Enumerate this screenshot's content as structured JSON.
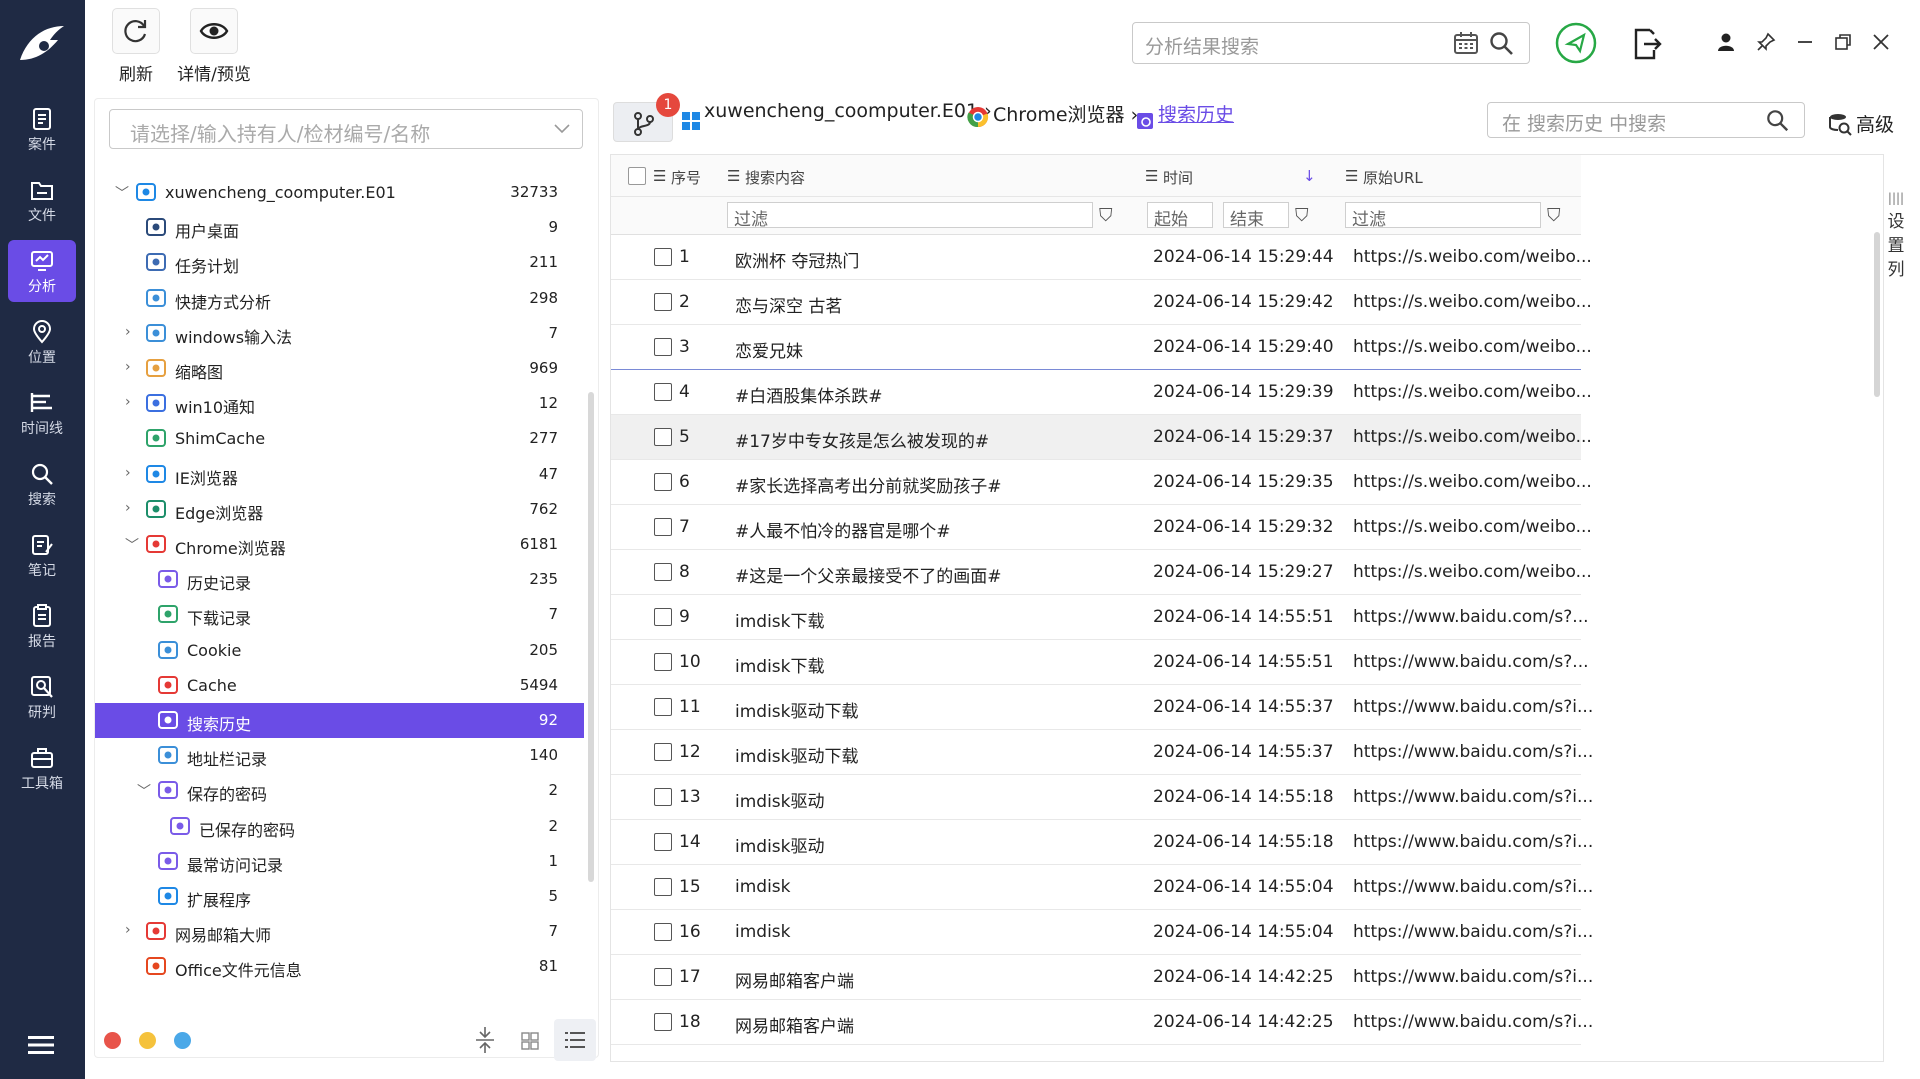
{
  "nav": {
    "items": [
      {
        "label": "案件",
        "icon": "case-icon"
      },
      {
        "label": "文件",
        "icon": "folder-icon"
      },
      {
        "label": "分析",
        "icon": "analysis-icon",
        "active": true
      },
      {
        "label": "位置",
        "icon": "location-icon"
      },
      {
        "label": "时间线",
        "icon": "timeline-icon"
      },
      {
        "label": "搜索",
        "icon": "search-icon"
      },
      {
        "label": "笔记",
        "icon": "note-icon"
      },
      {
        "label": "报告",
        "icon": "report-icon"
      },
      {
        "label": "研判",
        "icon": "judge-icon"
      },
      {
        "label": "工具箱",
        "icon": "toolbox-icon"
      }
    ],
    "active_color": "#6a4ce6",
    "bg_color": "#1f2a44"
  },
  "toolbar": {
    "refresh_label": "刷新",
    "detail_label": "详情/预览",
    "search_placeholder": "分析结果搜索"
  },
  "left": {
    "person_placeholder": "请选择/输入持有人/检材编号/名称",
    "tree": [
      {
        "label": "xuwencheng_coomputer.E01",
        "count": "32733",
        "level": 0,
        "expanded": true,
        "icon": "windows-icon"
      },
      {
        "label": "用户桌面",
        "count": "9",
        "level": 1,
        "icon": "desktop-icon"
      },
      {
        "label": "任务计划",
        "count": "211",
        "level": 1,
        "icon": "task-icon"
      },
      {
        "label": "快捷方式分析",
        "count": "298",
        "level": 1,
        "icon": "shortcut-icon"
      },
      {
        "label": "windows输入法",
        "count": "7",
        "level": 1,
        "collapsed": true,
        "icon": "keyboard-icon"
      },
      {
        "label": "缩略图",
        "count": "969",
        "level": 1,
        "collapsed": true,
        "icon": "thumbnail-icon"
      },
      {
        "label": "win10通知",
        "count": "12",
        "level": 1,
        "collapsed": true,
        "icon": "bell-icon"
      },
      {
        "label": "ShimCache",
        "count": "277",
        "level": 1,
        "icon": "cache-icon"
      },
      {
        "label": "IE浏览器",
        "count": "47",
        "level": 1,
        "collapsed": true,
        "icon": "ie-icon"
      },
      {
        "label": "Edge浏览器",
        "count": "762",
        "level": 1,
        "collapsed": true,
        "icon": "edge-icon"
      },
      {
        "label": "Chrome浏览器",
        "count": "6181",
        "level": 1,
        "expanded": true,
        "icon": "chrome-icon"
      },
      {
        "label": "历史记录",
        "count": "235",
        "level": 2,
        "icon": "history-icon"
      },
      {
        "label": "下载记录",
        "count": "7",
        "level": 2,
        "icon": "download-icon"
      },
      {
        "label": "Cookie",
        "count": "205",
        "level": 2,
        "icon": "cookie-icon"
      },
      {
        "label": "Cache",
        "count": "5494",
        "level": 2,
        "icon": "cache-red-icon"
      },
      {
        "label": "搜索历史",
        "count": "92",
        "level": 2,
        "selected": true,
        "icon": "search-history-icon"
      },
      {
        "label": "地址栏记录",
        "count": "140",
        "level": 2,
        "icon": "address-bar-icon"
      },
      {
        "label": "保存的密码",
        "count": "2",
        "level": 2,
        "expanded": true,
        "icon": "password-icon"
      },
      {
        "label": "已保存的密码",
        "count": "2",
        "level": 3,
        "icon": "saved-password-icon"
      },
      {
        "label": "最常访问记录",
        "count": "1",
        "level": 2,
        "icon": "most-visited-icon"
      },
      {
        "label": "扩展程序",
        "count": "5",
        "level": 2,
        "icon": "extension-icon"
      },
      {
        "label": "网易邮箱大师",
        "count": "7",
        "level": 1,
        "collapsed": true,
        "icon": "netease-mail-icon"
      },
      {
        "label": "Office文件元信息",
        "count": "81",
        "level": 1,
        "icon": "office-icon"
      }
    ]
  },
  "breadcrumb": {
    "badge": "1",
    "source": "xuwencheng_coomputer.E01",
    "browser": "Chrome浏览器",
    "current": "搜索历史",
    "sep": "›"
  },
  "grid": {
    "search_placeholder": "在 搜索历史 中搜索",
    "advanced_label": "高级",
    "columns": [
      "序号",
      "搜索内容",
      "时间",
      "原始URL"
    ],
    "filter_placeholder": "过滤",
    "start_label": "起始",
    "end_label": "结束",
    "set_columns_label": "设置列",
    "rows": [
      {
        "idx": "1",
        "query": "欧洲杯 夺冠热门",
        "time": "2024-06-14 15:29:44",
        "url": "https://s.weibo.com/weibo..."
      },
      {
        "idx": "2",
        "query": "恋与深空 古茗",
        "time": "2024-06-14 15:29:42",
        "url": "https://s.weibo.com/weibo..."
      },
      {
        "idx": "3",
        "query": "恋爱兄妹",
        "time": "2024-06-14 15:29:40",
        "url": "https://s.weibo.com/weibo..."
      },
      {
        "idx": "4",
        "query": "#白酒股集体杀跌#",
        "time": "2024-06-14 15:29:39",
        "url": "https://s.weibo.com/weibo..."
      },
      {
        "idx": "5",
        "query": "#17岁中专女孩是怎么被发现的#",
        "time": "2024-06-14 15:29:37",
        "url": "https://s.weibo.com/weibo..."
      },
      {
        "idx": "6",
        "query": "#家长选择高考出分前就奖励孩子#",
        "time": "2024-06-14 15:29:35",
        "url": "https://s.weibo.com/weibo..."
      },
      {
        "idx": "7",
        "query": "#人最不怕冷的器官是哪个#",
        "time": "2024-06-14 15:29:32",
        "url": "https://s.weibo.com/weibo..."
      },
      {
        "idx": "8",
        "query": "#这是一个父亲最接受不了的画面#",
        "time": "2024-06-14 15:29:27",
        "url": "https://s.weibo.com/weibo..."
      },
      {
        "idx": "9",
        "query": "imdisk下载",
        "time": "2024-06-14 14:55:51",
        "url": "https://www.baidu.com/s?..."
      },
      {
        "idx": "10",
        "query": "imdisk下载",
        "time": "2024-06-14 14:55:51",
        "url": "https://www.baidu.com/s?..."
      },
      {
        "idx": "11",
        "query": "imdisk驱动下载",
        "time": "2024-06-14 14:55:37",
        "url": "https://www.baidu.com/s?i..."
      },
      {
        "idx": "12",
        "query": "imdisk驱动下载",
        "time": "2024-06-14 14:55:37",
        "url": "https://www.baidu.com/s?i..."
      },
      {
        "idx": "13",
        "query": "imdisk驱动",
        "time": "2024-06-14 14:55:18",
        "url": "https://www.baidu.com/s?i..."
      },
      {
        "idx": "14",
        "query": "imdisk驱动",
        "time": "2024-06-14 14:55:18",
        "url": "https://www.baidu.com/s?i..."
      },
      {
        "idx": "15",
        "query": "imdisk",
        "time": "2024-06-14 14:55:04",
        "url": "https://www.baidu.com/s?i..."
      },
      {
        "idx": "16",
        "query": "imdisk",
        "time": "2024-06-14 14:55:04",
        "url": "https://www.baidu.com/s?i..."
      },
      {
        "idx": "17",
        "query": "网易邮箱客户端",
        "time": "2024-06-14 14:42:25",
        "url": "https://www.baidu.com/s?i..."
      },
      {
        "idx": "18",
        "query": "网易邮箱客户端",
        "time": "2024-06-14 14:42:25",
        "url": "https://www.baidu.com/s?i..."
      }
    ]
  }
}
